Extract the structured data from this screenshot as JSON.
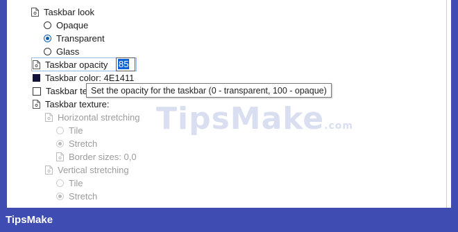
{
  "options": {
    "taskbar_look": {
      "label": "Taskbar look"
    },
    "look_choices": [
      {
        "label": "Opaque",
        "checked": false
      },
      {
        "label": "Transparent",
        "checked": true
      },
      {
        "label": "Glass",
        "checked": false
      }
    ],
    "opacity": {
      "label": "Taskbar opacity",
      "value": "85"
    },
    "color": {
      "label": "Taskbar color: 4E1411",
      "swatch": "#12123a"
    },
    "taskbar_t": {
      "label": "Taskbar te"
    },
    "texture": {
      "label": "Taskbar texture:"
    },
    "horizontal": {
      "label": "Horizontal stretching",
      "tile": "Tile",
      "stretch": "Stretch",
      "border_sizes": "Border sizes: 0,0"
    },
    "vertical": {
      "label": "Vertical stretching",
      "tile": "Tile",
      "stretch": "Stretch"
    }
  },
  "tooltip": "Set the opacity for the taskbar (0 - transparent, 100 - opaque)",
  "watermark": {
    "main": "TipsMake",
    "suffix": ".com"
  },
  "footer": {
    "brand": "TipsMake"
  },
  "colors": {
    "frame": "#3f4cb1",
    "accent": "#0b5cad",
    "selection": "#0a64d6"
  }
}
